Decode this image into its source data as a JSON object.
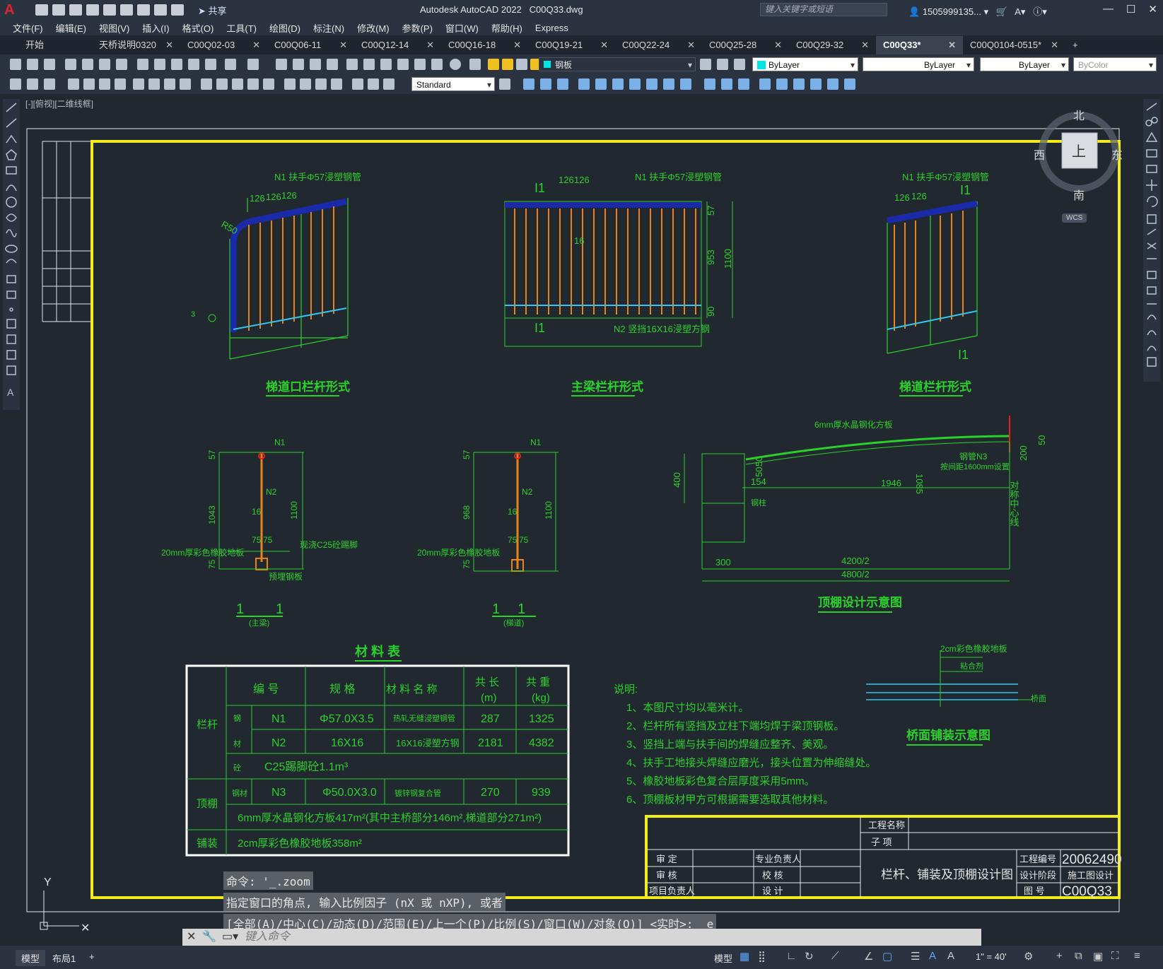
{
  "app": {
    "title": "Autodesk AutoCAD 2022",
    "file": "C00Q33.dwg",
    "search_placeholder": "键入关键字或短语",
    "user": "1505999135...",
    "share": "共享"
  },
  "menu": [
    "文件(F)",
    "编辑(E)",
    "视图(V)",
    "插入(I)",
    "格式(O)",
    "工具(T)",
    "绘图(D)",
    "标注(N)",
    "修改(M)",
    "参数(P)",
    "窗口(W)",
    "帮助(H)",
    "Express"
  ],
  "tabs": [
    {
      "label": "开始",
      "active": false
    },
    {
      "label": "天桥说明0320",
      "active": false
    },
    {
      "label": "C00Q02-03",
      "active": false
    },
    {
      "label": "C00Q06-11",
      "active": false
    },
    {
      "label": "C00Q12-14",
      "active": false
    },
    {
      "label": "C00Q16-18",
      "active": false
    },
    {
      "label": "C00Q19-21",
      "active": false
    },
    {
      "label": "C00Q22-24",
      "active": false
    },
    {
      "label": "C00Q25-28",
      "active": false
    },
    {
      "label": "C00Q29-32",
      "active": false
    },
    {
      "label": "C00Q33*",
      "active": true
    },
    {
      "label": "C00Q0104-0515*",
      "active": false
    }
  ],
  "toolbar": {
    "layer": "钢板",
    "color": "ByLayer",
    "linetype": "ByLayer",
    "lineweight": "ByLayer",
    "plotstyle": "ByColor",
    "textstyle": "Standard"
  },
  "viewport_label": "[-][俯视][二维线框]",
  "viewcube": {
    "north": "北",
    "south": "南",
    "east": "东",
    "west": "西",
    "top": "上",
    "wcs": "WCS"
  },
  "drawing": {
    "view_titles": [
      "梯道口栏杆形式",
      "主梁栏杆形式",
      "梯道栏杆形式",
      "顶棚设计示意图",
      "桥面铺装示意图",
      "材 料 表"
    ],
    "section_labels": [
      {
        "mark": "1",
        "sub": "(主梁)"
      },
      {
        "mark": "1",
        "sub": "(梯道)"
      }
    ],
    "annotations": {
      "n1": "N1 扶手Φ57浸塑钢管",
      "n2": "N2 竖挡16X16浸塑方钢",
      "n3": "钢管N3",
      "n3_sub": "按间距1600mm设置",
      "roof": "6mm厚水晶钢化方板",
      "c25": "现浇C25砼踢脚",
      "rubber": "20mm厚彩色橡胶地板",
      "plate": "预埋钢板",
      "deck_rubber": "2cm彩色橡胶地板",
      "glue": "粘合剂",
      "deck": "桥面",
      "column": "钢柱",
      "axis": "对称中心线"
    },
    "dims": {
      "a1": "126",
      "a2": "126",
      "r": "R50",
      "d57": "57",
      "d953": "953",
      "d1100": "1100",
      "d90": "90",
      "d16": "16",
      "d1043": "1043",
      "d968": "968",
      "d75": "75",
      "d20": "20",
      "d60": "60",
      "d400": "400",
      "d50": "50",
      "d200": "200",
      "d1085": "1085",
      "d154": "154",
      "d1946": "1946",
      "d300": "300",
      "d4200": "4200/2",
      "d4800": "4800/2"
    },
    "material_table": {
      "headers": [
        "编 号",
        "规 格",
        "材 料 名 称",
        "共 长\n(m)",
        "共 重\n(kg)"
      ],
      "rows": [
        {
          "group": "栏杆",
          "sub": "钢材",
          "code": "N1",
          "spec": "Φ57.0X3.5",
          "name": "热轧无缝浸塑钢管",
          "length": "287",
          "weight": "1325"
        },
        {
          "group": "",
          "sub": "",
          "code": "N2",
          "spec": "16X16",
          "name": "16X16浸塑方钢",
          "length": "2181",
          "weight": "4382"
        },
        {
          "group": "",
          "sub": "砼",
          "code": "C25踢脚砼1.1m³",
          "spec": "",
          "name": "",
          "length": "",
          "weight": ""
        },
        {
          "group": "顶棚",
          "sub": "钢材",
          "code": "N3",
          "spec": "Φ50.0X3.0",
          "name": "镀锌钢复合管",
          "length": "270",
          "weight": "939"
        },
        {
          "group": "",
          "sub": "",
          "code": "6mm厚水晶钢化方板417m²(其中主桥部分146m²,梯道部分271m²)",
          "spec": "",
          "name": "",
          "length": "",
          "weight": ""
        },
        {
          "group": "铺装",
          "sub": "",
          "code": "2cm厚彩色橡胶地板358m²",
          "spec": "",
          "name": "",
          "length": "",
          "weight": ""
        }
      ]
    },
    "notes_title": "说明:",
    "notes": [
      "1、本图尺寸均以毫米计。",
      "2、栏杆所有竖挡及立柱下端均焊于梁顶钢板。",
      "3、竖挡上端与扶手间的焊缝应整齐、美观。",
      "4、扶手工地接头焊缝应磨光，接头位置为伸缩缝处。",
      "5、橡胶地板彩色复合层厚度采用5mm。",
      "6、顶棚板材甲方可根据需要选取其他材料。"
    ],
    "title_block": {
      "project_name_label": "工程名称",
      "sub_item_label": "子 项",
      "approve": "审 定",
      "review": "审 核",
      "project_lead": "项目负责人",
      "spec_lead": "专业负责人",
      "check": "校 核",
      "design": "设 计",
      "drawing_title": "栏杆、铺装及顶棚设计图",
      "project_no_label": "工程编号",
      "project_no": "20062490",
      "stage_label": "设计阶段",
      "stage": "施工图设计",
      "drawing_no_label": "图 号",
      "drawing_no": "C00Q33"
    }
  },
  "command": {
    "history": [
      "命令: '_.zoom",
      "指定窗口的角点, 输入比例因子 (nX 或 nXP), 或者",
      "[全部(A)/中心(C)/动态(D)/范围(E)/上一个(P)/比例(S)/窗口(W)/对象(O)] <实时>: _e"
    ],
    "placeholder": "键入命令"
  },
  "status": {
    "tabs": [
      "模型",
      "布局1",
      "+"
    ],
    "model": "模型",
    "scale": "1\" = 40'"
  }
}
